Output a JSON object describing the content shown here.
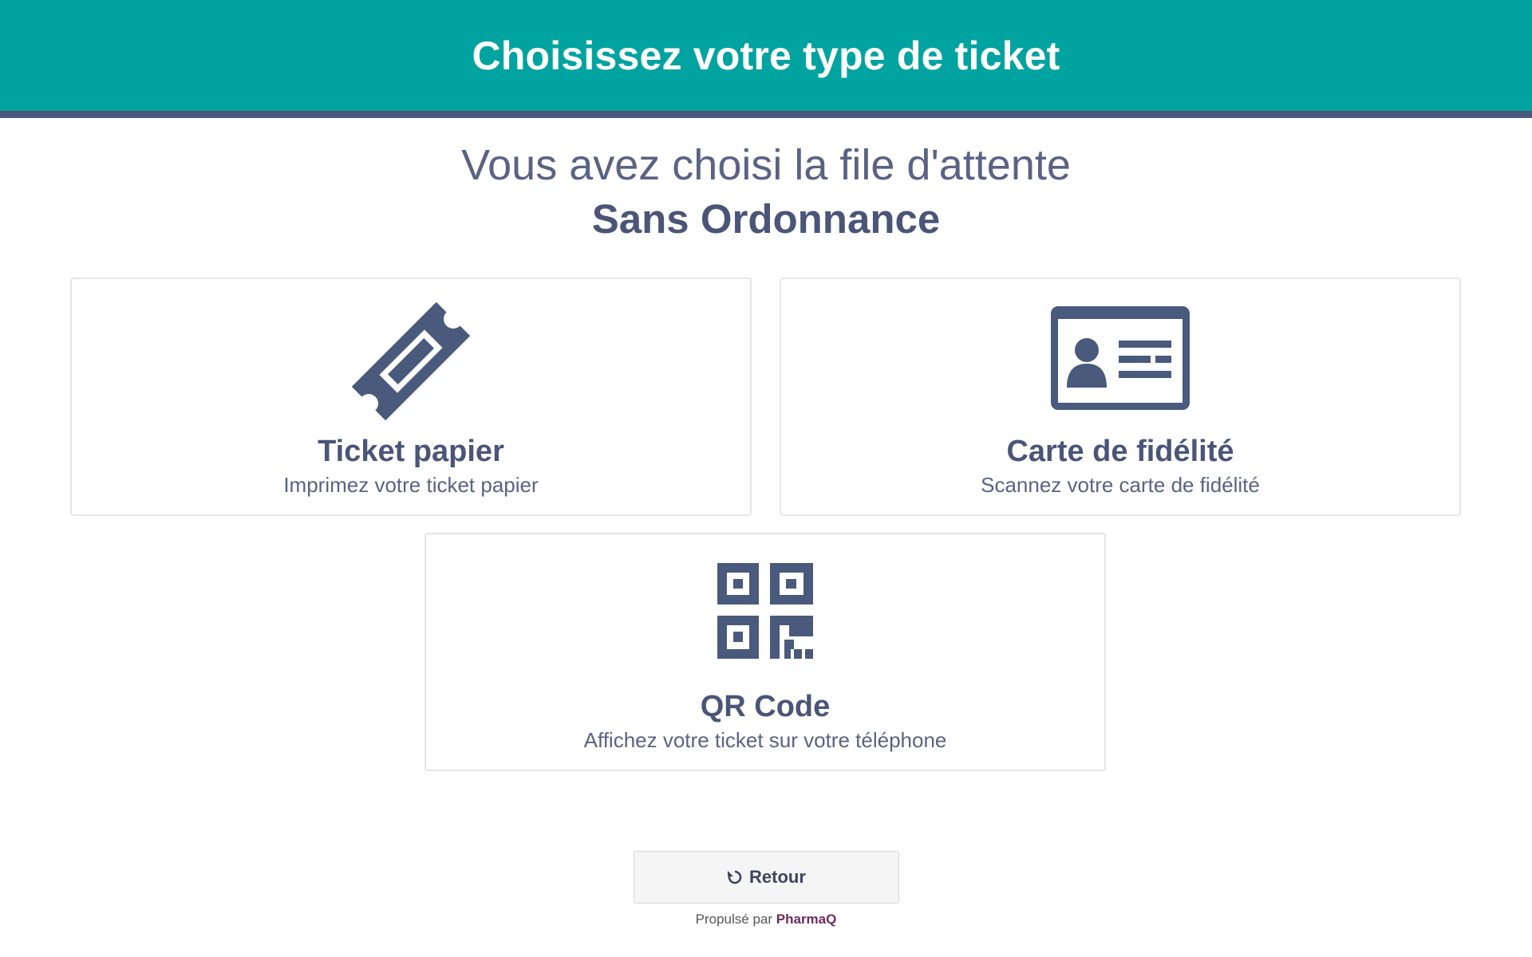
{
  "header": {
    "title": "Choisissez votre type de ticket"
  },
  "intro": {
    "line1": "Vous avez choisi la file d'attente",
    "queue_name": "Sans Ordonnance"
  },
  "options": [
    {
      "icon": "ticket-icon",
      "title": "Ticket papier",
      "description": "Imprimez votre ticket papier"
    },
    {
      "icon": "id-card-icon",
      "title": "Carte de fidélité",
      "description": "Scannez votre carte de fidélité"
    },
    {
      "icon": "qr-code-icon",
      "title": "QR Code",
      "description": "Affichez votre ticket sur votre téléphone"
    }
  ],
  "back_button": {
    "icon": "undo-icon",
    "label": "Retour"
  },
  "footer": {
    "prefix": "Propulsé par",
    "brand": "PharmaQ"
  },
  "colors": {
    "header_bg": "#00a3a0",
    "header_border": "#4a5a7d",
    "icon_color": "#4a5a7d",
    "brand_color": "#6b2b5e"
  }
}
